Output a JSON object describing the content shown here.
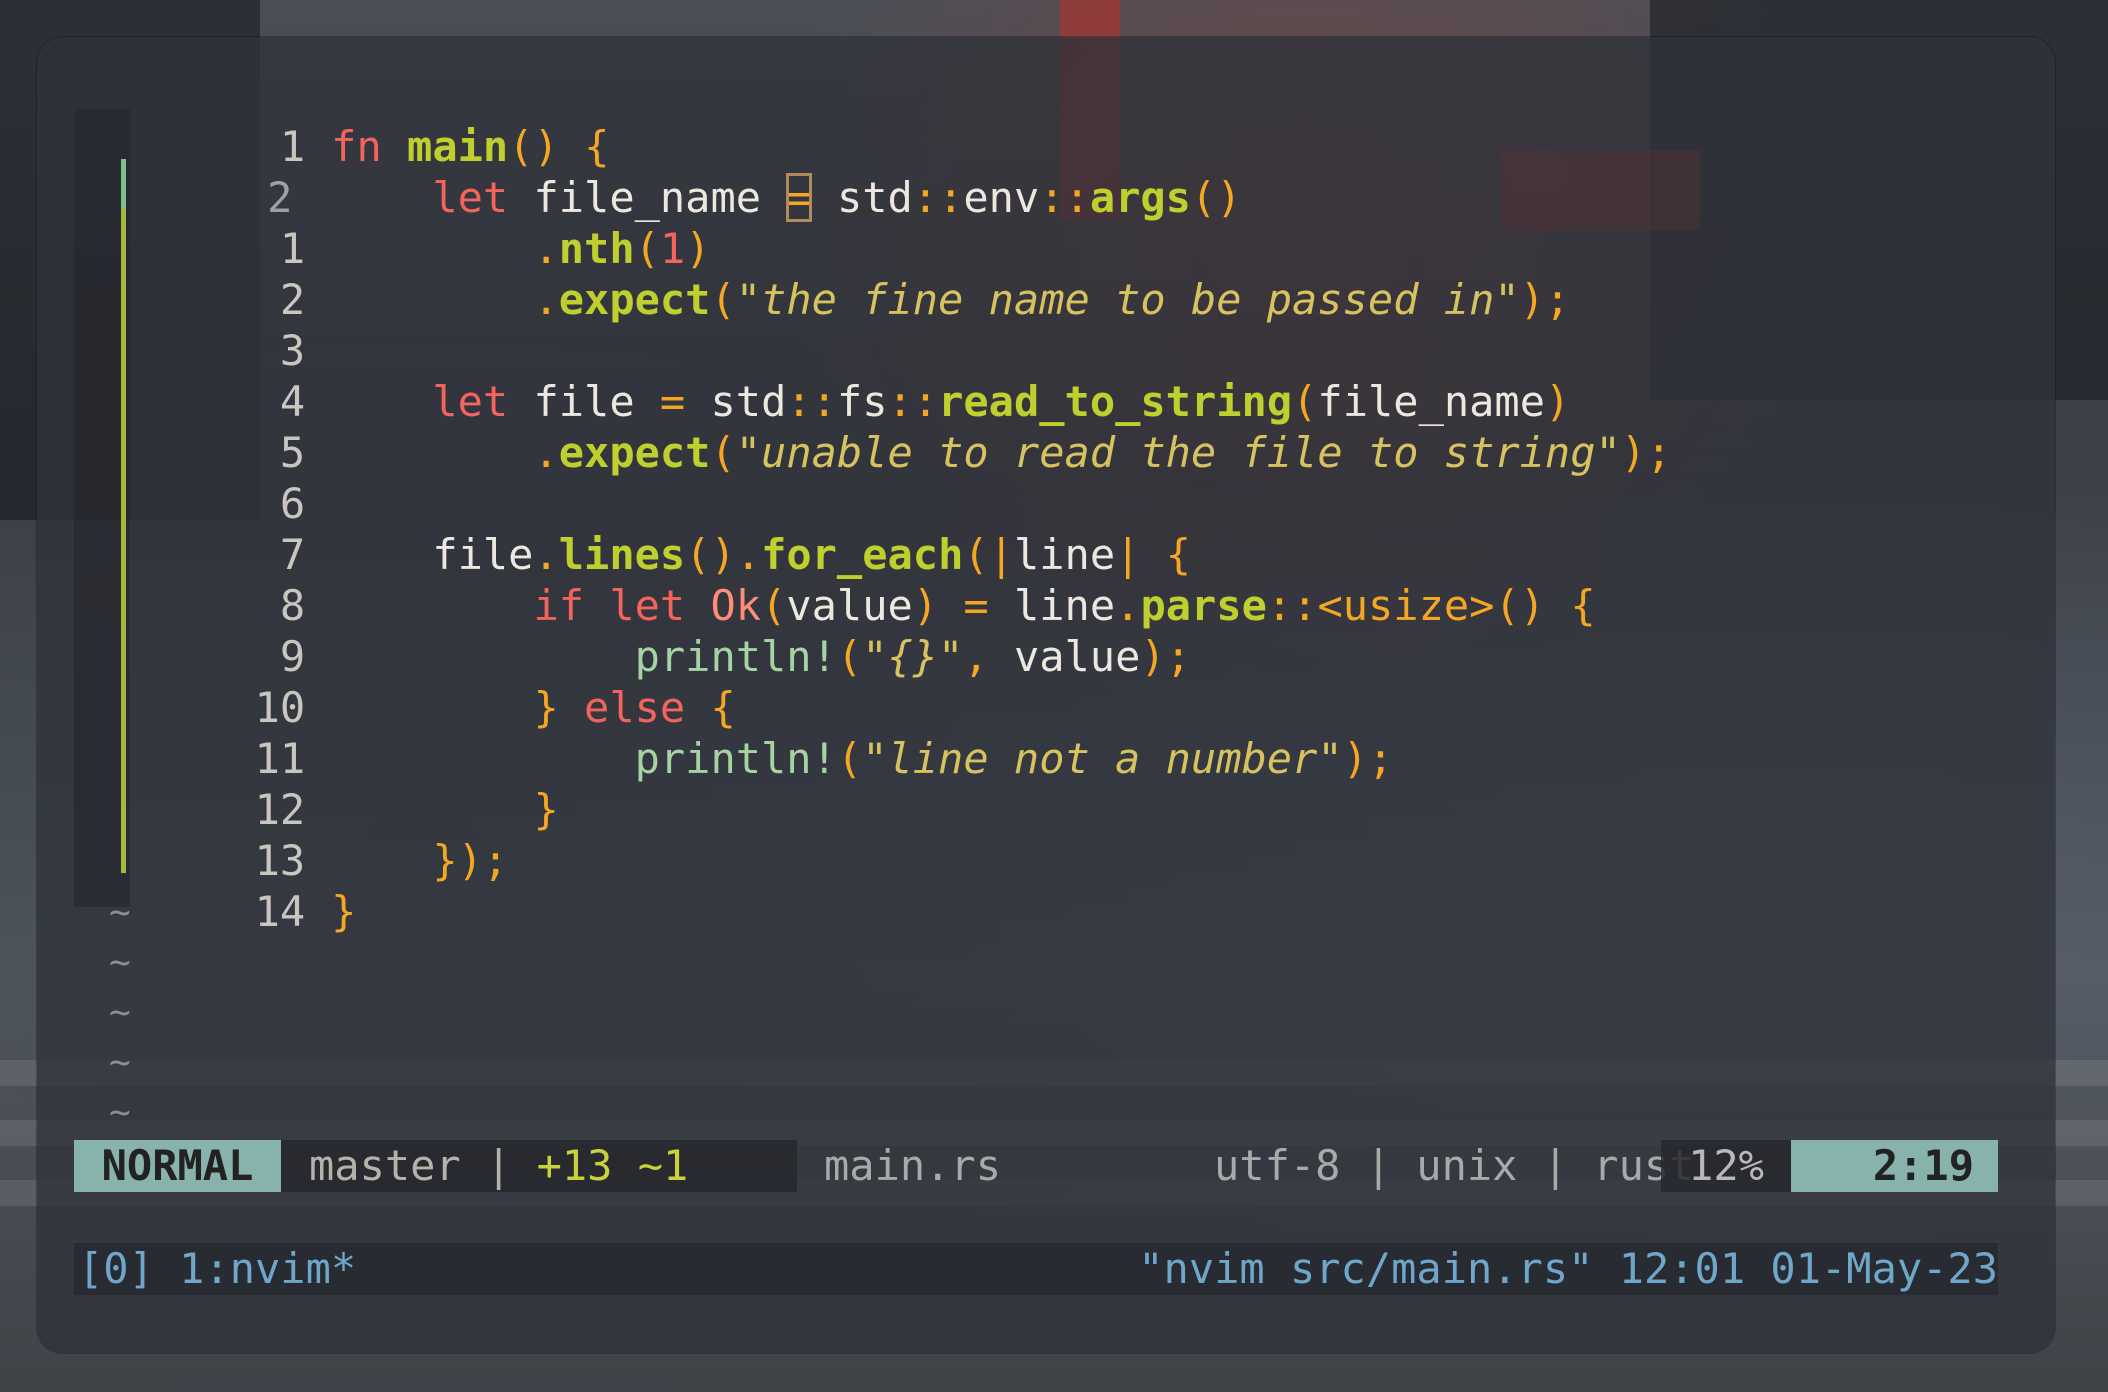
{
  "editor": {
    "lines": [
      {
        "num": "1",
        "current": false
      },
      {
        "num": "2",
        "current": true
      },
      {
        "num": "1",
        "current": false
      },
      {
        "num": "2",
        "current": false
      },
      {
        "num": "3",
        "current": false
      },
      {
        "num": "4",
        "current": false
      },
      {
        "num": "5",
        "current": false
      },
      {
        "num": "6",
        "current": false
      },
      {
        "num": "7",
        "current": false
      },
      {
        "num": "8",
        "current": false
      },
      {
        "num": "9",
        "current": false
      },
      {
        "num": "10",
        "current": false
      },
      {
        "num": "11",
        "current": false
      },
      {
        "num": "12",
        "current": false
      },
      {
        "num": "13",
        "current": false
      },
      {
        "num": "14",
        "current": false
      }
    ],
    "code": {
      "l0": {
        "fn_kw": "fn",
        "name": "main",
        "parens": "()",
        "brace": "{"
      },
      "l1": {
        "let_kw": "let",
        "ident": "file_name",
        "eq": "=",
        "path1": "std",
        "sep1": "::",
        "path2": "env",
        "sep2": "::",
        "call": "args",
        "parens": "()"
      },
      "l2": {
        "dot": ".",
        "call": "nth",
        "open": "(",
        "arg": "1",
        "close": ")"
      },
      "l3": {
        "dot": ".",
        "call": "expect",
        "open": "(",
        "str": "\"the fine name to be passed in\"",
        "close": ");"
      },
      "l5": {
        "let_kw": "let",
        "ident": "file",
        "eq": "=",
        "path1": "std",
        "sep1": "::",
        "path2": "fs",
        "sep2": "::",
        "call": "read_to_string",
        "open": "(",
        "arg": "file_name",
        "close": ")"
      },
      "l6": {
        "dot": ".",
        "call": "expect",
        "open": "(",
        "str": "\"unable to read the file to string\"",
        "close": ");"
      },
      "l8": {
        "ident": "file",
        "dot1": ".",
        "call1": "lines",
        "p1": "()",
        "dot2": ".",
        "call2": "for_each",
        "open": "(",
        "pipe1": "|",
        "arg": "line",
        "pipe2": "|",
        "brace": "{"
      },
      "l9": {
        "if_kw": "if",
        "let_kw": "let",
        "ty": "Ok",
        "open": "(",
        "val": "value",
        "close": ")",
        "eq": "=",
        "ident": "line",
        "dot": ".",
        "call": "parse",
        "turbo": "::<usize>",
        "parens": "()",
        "brace": "{"
      },
      "l10": {
        "mac": "println!",
        "open": "(",
        "str": "\"{}\"",
        "comma": ",",
        "val": "value",
        "close": ");"
      },
      "l11": {
        "rbrace": "}",
        "else_kw": "else",
        "lbrace": "{"
      },
      "l12": {
        "mac": "println!",
        "open": "(",
        "str": "\"line not a number\"",
        "close": ");"
      },
      "l13": {
        "rbrace": "}"
      },
      "l14": {
        "close": "});"
      },
      "l15": {
        "rbrace": "}"
      }
    },
    "tilde": "~"
  },
  "statusline": {
    "mode": "NORMAL",
    "branch": "master",
    "sep": "|",
    "diff": "+13 ~1",
    "file": "main.rs",
    "info": "utf-8 | unix | rust",
    "percent": "12%",
    "position": "2:19"
  },
  "tmux": {
    "left": "[0] 1:nvim*",
    "right": "\"nvim src/main.rs\" 12:01 01-May-23"
  },
  "colors": {
    "keyword": "#f4645c",
    "function": "#bfcf2e",
    "bracket": "#f5a623",
    "string": "#d6c25e",
    "mode_bg": "#87b3ac",
    "tmux_text": "#6ea7c9"
  }
}
